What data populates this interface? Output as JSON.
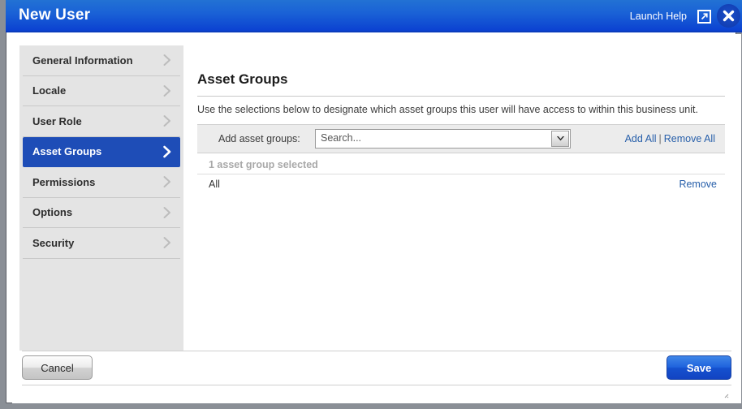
{
  "window": {
    "title": "New User",
    "launch_help_label": "Launch Help",
    "popout_icon": "popout-window-icon",
    "close_icon": "close-icon",
    "titlebar_color": "#1a62d6",
    "accent_color": "#1e4db7"
  },
  "sidebar": {
    "items": [
      {
        "label": "General Information",
        "selected": false
      },
      {
        "label": "Locale",
        "selected": false
      },
      {
        "label": "User Role",
        "selected": false
      },
      {
        "label": "Asset Groups",
        "selected": true
      },
      {
        "label": "Permissions",
        "selected": false
      },
      {
        "label": "Options",
        "selected": false
      },
      {
        "label": "Security",
        "selected": false
      }
    ]
  },
  "content": {
    "panel_title": "Asset Groups",
    "description": "Use the selections below to designate which asset groups this user will have access to within this business unit.",
    "add_label": "Add asset groups:",
    "search_value": "Search...",
    "search_placeholder": "Search...",
    "dropdown_icon": "chevron-down-icon",
    "add_all_label": "Add All",
    "link_separator": "|",
    "remove_all_label": "Remove All",
    "selected_count_text": "1 asset group selected",
    "rows": [
      {
        "name": "All",
        "remove_label": "Remove"
      }
    ],
    "scrollbar": {
      "left_arrow_icon": "scroll-left-arrow-icon",
      "right_arrow_icon": "scroll-right-arrow-icon"
    }
  },
  "footer": {
    "cancel_label": "Cancel",
    "save_label": "Save"
  }
}
